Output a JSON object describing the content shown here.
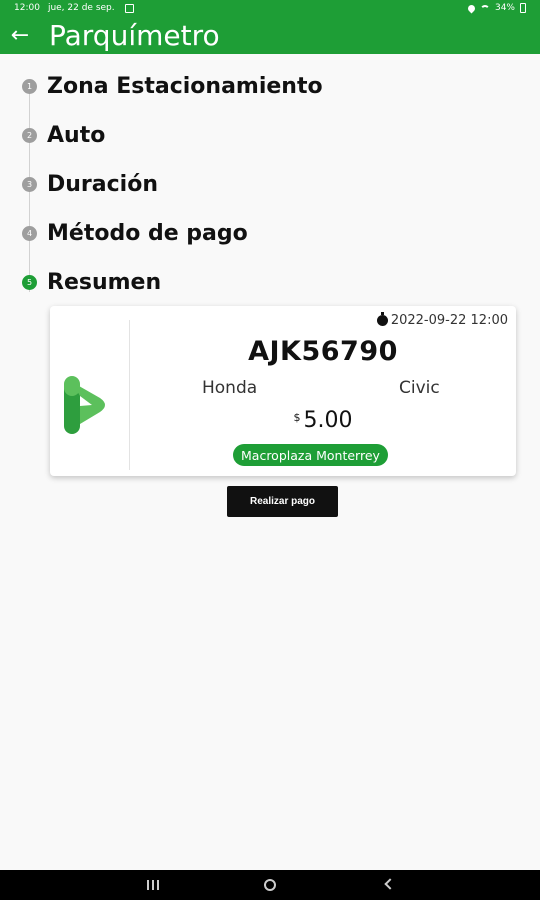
{
  "status_bar": {
    "time": "12:00",
    "date": "jue, 22 de sep.",
    "battery": "34%"
  },
  "app_bar": {
    "title": "Parquímetro"
  },
  "steps": [
    {
      "number": "1",
      "label": "Zona Estacionamiento"
    },
    {
      "number": "2",
      "label": "Auto"
    },
    {
      "number": "3",
      "label": "Duración"
    },
    {
      "number": "4",
      "label": "Método de pago"
    },
    {
      "number": "5",
      "label": "Resumen"
    }
  ],
  "summary": {
    "datetime": "2022-09-22 12:00",
    "plate": "AJK56790",
    "brand": "Honda",
    "model": "Civic",
    "currency_symbol": "$",
    "amount": "5.00",
    "zone": "Macroplaza Monterrey"
  },
  "actions": {
    "pay_label": "Realizar pago"
  },
  "colors": {
    "primary": "#1e9e36",
    "step_inactive": "#9e9e9e",
    "button_dark": "#111111",
    "logo_dark": "#2e9e3e",
    "logo_light": "#5cc05c"
  },
  "icons": {
    "back": "arrow-back-icon",
    "timer": "timer-icon",
    "logo": "parking-p-logo",
    "nav_recents": "recents-icon",
    "nav_home": "home-icon",
    "nav_back": "nav-back-icon"
  }
}
